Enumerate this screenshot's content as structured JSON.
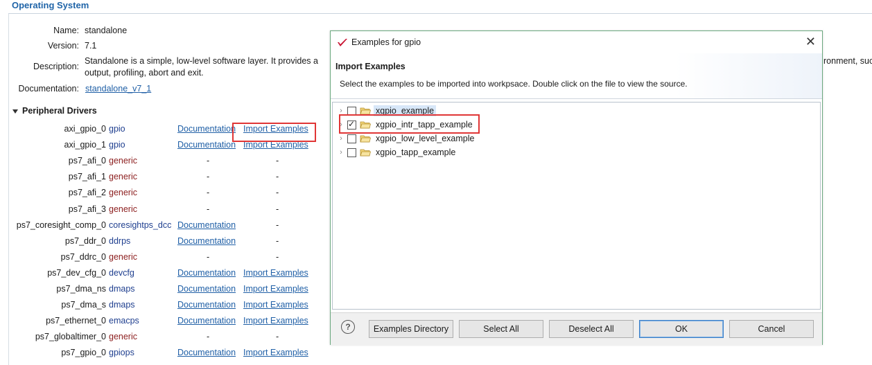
{
  "os_section": {
    "title": "Operating System",
    "name_label": "Name:",
    "name_value": "standalone",
    "version_label": "Version:",
    "version_value": "7.1",
    "description_label": "Description:",
    "description_line1": "Standalone is a simple, low-level software layer. It provides a",
    "description_line1_tail": "ronment, suc",
    "description_line2": "output, profiling, abort and exit.",
    "documentation_label": "Documentation:",
    "documentation_link": "standalone_v7_1"
  },
  "peripheral": {
    "title": "Peripheral Drivers",
    "rows": [
      {
        "name": "axi_gpio_0",
        "driver": "gpio",
        "driver_kind": "normal",
        "doc": "Documentation",
        "import": "Import Examples"
      },
      {
        "name": "axi_gpio_1",
        "driver": "gpio",
        "driver_kind": "normal",
        "doc": "Documentation",
        "import": "Import Examples"
      },
      {
        "name": "ps7_afi_0",
        "driver": "generic",
        "driver_kind": "generic",
        "doc": "-",
        "import": "-"
      },
      {
        "name": "ps7_afi_1",
        "driver": "generic",
        "driver_kind": "generic",
        "doc": "-",
        "import": "-"
      },
      {
        "name": "ps7_afi_2",
        "driver": "generic",
        "driver_kind": "generic",
        "doc": "-",
        "import": "-"
      },
      {
        "name": "ps7_afi_3",
        "driver": "generic",
        "driver_kind": "generic",
        "doc": "-",
        "import": "-"
      },
      {
        "name": "ps7_coresight_comp_0",
        "driver": "coresightps_dcc",
        "driver_kind": "normal",
        "doc": "Documentation",
        "import": "-"
      },
      {
        "name": "ps7_ddr_0",
        "driver": "ddrps",
        "driver_kind": "normal",
        "doc": "Documentation",
        "import": "-"
      },
      {
        "name": "ps7_ddrc_0",
        "driver": "generic",
        "driver_kind": "generic",
        "doc": "-",
        "import": "-"
      },
      {
        "name": "ps7_dev_cfg_0",
        "driver": "devcfg",
        "driver_kind": "normal",
        "doc": "Documentation",
        "import": "Import Examples"
      },
      {
        "name": "ps7_dma_ns",
        "driver": "dmaps",
        "driver_kind": "normal",
        "doc": "Documentation",
        "import": "Import Examples"
      },
      {
        "name": "ps7_dma_s",
        "driver": "dmaps",
        "driver_kind": "normal",
        "doc": "Documentation",
        "import": "Import Examples"
      },
      {
        "name": "ps7_ethernet_0",
        "driver": "emacps",
        "driver_kind": "normal",
        "doc": "Documentation",
        "import": "Import Examples"
      },
      {
        "name": "ps7_globaltimer_0",
        "driver": "generic",
        "driver_kind": "generic",
        "doc": "-",
        "import": "-"
      },
      {
        "name": "ps7_gpio_0",
        "driver": "gpiops",
        "driver_kind": "normal",
        "doc": "Documentation",
        "import": "Import Examples"
      }
    ]
  },
  "dialog": {
    "title": "Examples for gpio",
    "header_title": "Import Examples",
    "header_desc": "Select the examples to be imported into workpsace. Double click on the file to view the source.",
    "items": [
      {
        "label": "xgpio_example",
        "checked": false,
        "selected": true
      },
      {
        "label": "xgpio_intr_tapp_example",
        "checked": true,
        "selected": false
      },
      {
        "label": "xgpio_low_level_example",
        "checked": false,
        "selected": false
      },
      {
        "label": "xgpio_tapp_example",
        "checked": false,
        "selected": false
      }
    ],
    "buttons": {
      "help": "?",
      "examples_directory": "Examples Directory",
      "select_all": "Select All",
      "deselect_all": "Deselect All",
      "ok": "OK",
      "cancel": "Cancel"
    },
    "close_glyph": "✕"
  },
  "colors": {
    "accent": "#1f64a8",
    "link": "#1f5fa6",
    "generic_driver": "#8b1c1c",
    "highlight_box": "#e03535",
    "dialog_border": "#6aa87e"
  }
}
